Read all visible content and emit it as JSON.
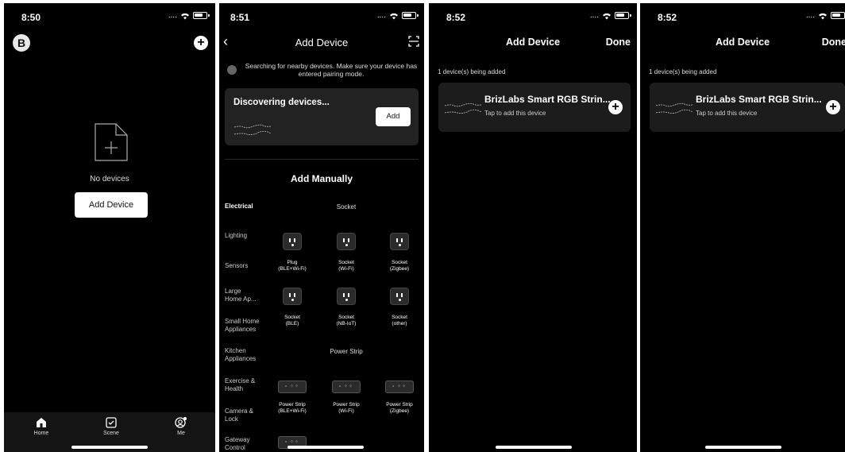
{
  "screen1": {
    "time": "8:50",
    "logo": "B",
    "empty_text": "No devices",
    "add_button": "Add Device",
    "tabs": [
      {
        "label": "Home",
        "icon": "home-icon"
      },
      {
        "label": "Scene",
        "icon": "scene-icon"
      },
      {
        "label": "Me",
        "icon": "me-icon"
      }
    ]
  },
  "screen2": {
    "time": "8:51",
    "title": "Add Device",
    "search_hint": "Searching for nearby devices. Make sure your device has entered pairing mode.",
    "discovering": "Discovering devices...",
    "discover_add": "Add",
    "manual_title": "Add Manually",
    "categories": [
      "Electrical",
      "Lighting",
      "Sensors",
      "Large Home Ap...",
      "Small Home Appliances",
      "Kitchen Appliances",
      "Exercise & Health",
      "Camera & Lock",
      "Gateway Control"
    ],
    "socket_group": "Socket",
    "sockets": [
      {
        "name": "Plug",
        "sub": "(BLE+Wi-Fi)"
      },
      {
        "name": "Socket",
        "sub": "(Wi-Fi)"
      },
      {
        "name": "Socket",
        "sub": "(Zigbee)"
      },
      {
        "name": "Socket",
        "sub": "(BLE)"
      },
      {
        "name": "Socket",
        "sub": "(NB-IoT)"
      },
      {
        "name": "Socket",
        "sub": "(other)"
      }
    ],
    "strip_group": "Power Strip",
    "strips": [
      {
        "name": "Power Strip",
        "sub": "(BLE+Wi-Fi)"
      },
      {
        "name": "Power Strip",
        "sub": "(Wi-Fi)"
      },
      {
        "name": "Power Strip",
        "sub": "(Zigbee)"
      }
    ]
  },
  "screen3": {
    "time": "8:52",
    "title": "Add Device",
    "done": "Done",
    "adding_text": "1 device(s) being added",
    "device_name": "BrizLabs Smart RGB Strin...",
    "device_sub": "Tap to add this device"
  },
  "screen4": {
    "time": "8:52",
    "title": "Add Device",
    "done": "Done",
    "adding_text": "1 device(s) being added",
    "device_name": "BrizLabs Smart RGB Strin...",
    "device_sub": "Tap to add this device"
  },
  "status_signal": "....",
  "colors": {
    "background": "#000000",
    "card": "#222222",
    "button": "#ffffff"
  }
}
